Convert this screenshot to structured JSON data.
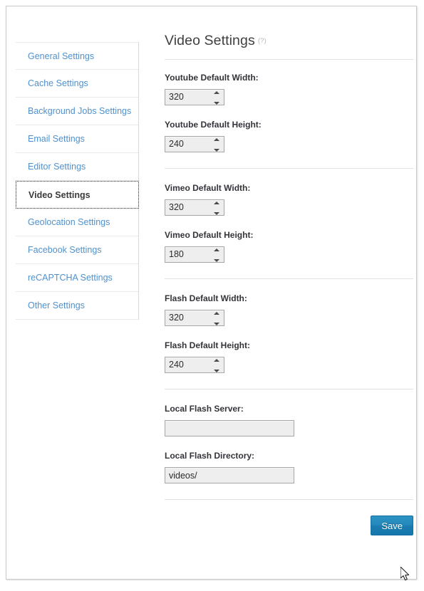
{
  "sidebar": {
    "items": [
      {
        "label": "General Settings",
        "active": false
      },
      {
        "label": "Cache Settings",
        "active": false
      },
      {
        "label": "Background Jobs Settings",
        "active": false
      },
      {
        "label": "Email Settings",
        "active": false
      },
      {
        "label": "Editor Settings",
        "active": false
      },
      {
        "label": "Video Settings",
        "active": true
      },
      {
        "label": "Geolocation Settings",
        "active": false
      },
      {
        "label": "Facebook Settings",
        "active": false
      },
      {
        "label": "reCAPTCHA Settings",
        "active": false
      },
      {
        "label": "Other Settings",
        "active": false
      }
    ]
  },
  "main": {
    "title": "Video Settings",
    "help_label": "(?)",
    "fields": [
      {
        "label": "Youtube Default Width:",
        "value": "320",
        "type": "number"
      },
      {
        "label": "Youtube Default Height:",
        "value": "240",
        "type": "number"
      },
      {
        "label": "Vimeo Default Width:",
        "value": "320",
        "type": "number"
      },
      {
        "label": "Vimeo Default Height:",
        "value": "180",
        "type": "number"
      },
      {
        "label": "Flash Default Width:",
        "value": "320",
        "type": "number"
      },
      {
        "label": "Flash Default Height:",
        "value": "240",
        "type": "number"
      },
      {
        "label": "Local Flash Server:",
        "value": "",
        "type": "text"
      },
      {
        "label": "Local Flash Directory:",
        "value": "videos/",
        "type": "text"
      }
    ],
    "save_label": "Save"
  },
  "colors": {
    "link": "#5091cd",
    "label": "#33343a",
    "title": "#3f3f3f",
    "button_top": "#2d93c4",
    "button_bottom": "#1577ab",
    "input_bg": "#eeeeee",
    "input_border": "#a6a6a6",
    "divider": "#e2e2e2"
  }
}
